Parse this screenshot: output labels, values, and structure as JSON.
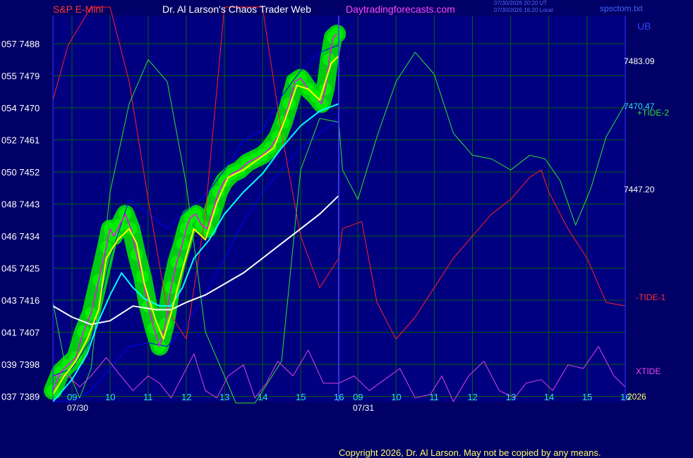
{
  "header": {
    "instrument": "S&P E-Mini",
    "title": "Dr. Al Larson's Chaos Trader Web",
    "site": "Daytradingforecasts.com",
    "stamp_line1": "07/30/2026 20:20 UT",
    "stamp_line2": "07/30/2026 16:20 Local",
    "file": "spsctom.txt"
  },
  "footer": {
    "copyright": "Copyright 2026, Dr. Al Larson. May not be copied by any means."
  },
  "colors": {
    "background": "#000066",
    "plot_background": "#000080",
    "grid": "#0b5d0b",
    "price": "#ff00ff",
    "price_band": "#00ee00",
    "fast_avg": "#ffff00",
    "mid_avg": "#00ffff",
    "slow_avg": "#ffffff",
    "band": "#0000ff",
    "tide1": "#ff2020",
    "tide2": "#30e030",
    "xtide": "#dd44dd",
    "text_header_red": "#ff3333",
    "text_header_white": "#ffffff",
    "text_header_magenta": "#ff44ff"
  },
  "chart_data": {
    "type": "line",
    "y_ticks": [
      "057 7488",
      "055 7479",
      "054 7470",
      "052 7461",
      "050 7452",
      "048 7443",
      "046 7434",
      "045 7425",
      "043 7416",
      "041 7407",
      "039 7398",
      "037 7389"
    ],
    "ylim": [
      7389,
      7494
    ],
    "x_ticks": [
      "09",
      "10",
      "11",
      "12",
      "13",
      "14",
      "15",
      "16",
      "09",
      "10",
      "11",
      "12",
      "13",
      "14",
      "15",
      "16"
    ],
    "date_labels": [
      "07/30",
      "07/31"
    ],
    "right_labels": {
      "ub": "UB",
      "v1": "7483.09",
      "v2": "7470.47",
      "v3": "7447.20",
      "tide2": "+TIDE-2",
      "tide1": "-TIDE-1",
      "xtide": "XTIDE",
      "year": "2026"
    },
    "x_hours_day1": [
      8.5,
      16
    ],
    "x_hours_day2": [
      16,
      23.5
    ],
    "series": [
      {
        "key": "price",
        "values": [
          [
            8.5,
            7392
          ],
          [
            8.7,
            7397
          ],
          [
            8.9,
            7399
          ],
          [
            9.1,
            7401
          ],
          [
            9.3,
            7408
          ],
          [
            9.5,
            7413
          ],
          [
            9.7,
            7422
          ],
          [
            9.9,
            7431
          ],
          [
            10.0,
            7436
          ],
          [
            10.1,
            7434
          ],
          [
            10.25,
            7437
          ],
          [
            10.4,
            7440
          ],
          [
            10.55,
            7436
          ],
          [
            10.7,
            7429
          ],
          [
            10.85,
            7423
          ],
          [
            11.0,
            7415
          ],
          [
            11.15,
            7409
          ],
          [
            11.3,
            7404
          ],
          [
            11.45,
            7410
          ],
          [
            11.6,
            7420
          ],
          [
            11.75,
            7427
          ],
          [
            11.9,
            7432
          ],
          [
            12.0,
            7436
          ],
          [
            12.1,
            7439
          ],
          [
            12.25,
            7440
          ],
          [
            12.4,
            7437
          ],
          [
            12.55,
            7436
          ],
          [
            12.7,
            7441
          ],
          [
            12.85,
            7446
          ],
          [
            13.0,
            7449
          ],
          [
            13.2,
            7451
          ],
          [
            13.4,
            7452
          ],
          [
            13.6,
            7454
          ],
          [
            13.8,
            7455
          ],
          [
            14.0,
            7456
          ],
          [
            14.2,
            7458
          ],
          [
            14.4,
            7461
          ],
          [
            14.55,
            7465
          ],
          [
            14.7,
            7470
          ],
          [
            14.85,
            7476
          ],
          [
            15.0,
            7477
          ],
          [
            15.2,
            7474
          ],
          [
            15.4,
            7472
          ],
          [
            15.55,
            7470
          ],
          [
            15.65,
            7474
          ],
          [
            15.75,
            7482
          ],
          [
            15.85,
            7488
          ],
          [
            15.95,
            7489
          ]
        ]
      },
      {
        "key": "fast_avg",
        "values": [
          [
            8.5,
            7391
          ],
          [
            8.8,
            7396
          ],
          [
            9.1,
            7400
          ],
          [
            9.4,
            7406
          ],
          [
            9.7,
            7414
          ],
          [
            9.9,
            7428
          ],
          [
            10.2,
            7433
          ],
          [
            10.5,
            7436
          ],
          [
            10.7,
            7432
          ],
          [
            10.9,
            7421
          ],
          [
            11.2,
            7411
          ],
          [
            11.4,
            7406
          ],
          [
            11.6,
            7413
          ],
          [
            11.9,
            7425
          ],
          [
            12.2,
            7436
          ],
          [
            12.5,
            7433
          ],
          [
            12.8,
            7443
          ],
          [
            13.1,
            7450
          ],
          [
            13.5,
            7452
          ],
          [
            13.9,
            7455
          ],
          [
            14.3,
            7458
          ],
          [
            14.6,
            7466
          ],
          [
            14.9,
            7475
          ],
          [
            15.2,
            7474
          ],
          [
            15.5,
            7471
          ],
          [
            15.8,
            7481
          ],
          [
            16.0,
            7483
          ]
        ]
      },
      {
        "key": "mid_avg",
        "values": [
          [
            8.5,
            7389
          ],
          [
            9.0,
            7395
          ],
          [
            9.4,
            7402
          ],
          [
            9.7,
            7411
          ],
          [
            10.0,
            7418
          ],
          [
            10.3,
            7424
          ],
          [
            10.6,
            7420
          ],
          [
            10.9,
            7417
          ],
          [
            11.3,
            7415
          ],
          [
            11.6,
            7415
          ],
          [
            11.9,
            7420
          ],
          [
            12.2,
            7428
          ],
          [
            12.6,
            7433
          ],
          [
            13.0,
            7440
          ],
          [
            13.5,
            7446
          ],
          [
            14.0,
            7451
          ],
          [
            14.5,
            7458
          ],
          [
            15.0,
            7464
          ],
          [
            15.5,
            7468
          ],
          [
            16.0,
            7470
          ]
        ]
      },
      {
        "key": "slow_avg",
        "values": [
          [
            8.5,
            7415
          ],
          [
            9.0,
            7412
          ],
          [
            9.5,
            7410
          ],
          [
            10.0,
            7411
          ],
          [
            10.6,
            7415
          ],
          [
            11.2,
            7414
          ],
          [
            11.6,
            7414
          ],
          [
            12.0,
            7416
          ],
          [
            12.5,
            7418
          ],
          [
            13.0,
            7421
          ],
          [
            13.5,
            7424
          ],
          [
            14.0,
            7428
          ],
          [
            14.5,
            7432
          ],
          [
            15.0,
            7436
          ],
          [
            15.5,
            7440
          ],
          [
            16.0,
            7445
          ]
        ]
      },
      {
        "key": "band_upper",
        "values": [
          [
            8.5,
            7396
          ],
          [
            9.0,
            7398
          ],
          [
            9.5,
            7406
          ],
          [
            10.0,
            7428
          ],
          [
            10.5,
            7444
          ],
          [
            11.0,
            7440
          ],
          [
            11.5,
            7436
          ],
          [
            12.0,
            7441
          ],
          [
            12.5,
            7445
          ],
          [
            13.0,
            7452
          ],
          [
            13.5,
            7460
          ],
          [
            14.0,
            7463
          ],
          [
            14.5,
            7472
          ],
          [
            15.0,
            7479
          ],
          [
            15.5,
            7484
          ],
          [
            16.0,
            7486
          ]
        ]
      },
      {
        "key": "band_lower",
        "values": [
          [
            8.5,
            7389
          ],
          [
            9.0,
            7389
          ],
          [
            9.5,
            7392
          ],
          [
            10.0,
            7398
          ],
          [
            10.5,
            7404
          ],
          [
            11.0,
            7405
          ],
          [
            11.5,
            7404
          ],
          [
            12.0,
            7410
          ],
          [
            12.5,
            7418
          ],
          [
            13.0,
            7428
          ],
          [
            13.5,
            7438
          ],
          [
            14.0,
            7446
          ],
          [
            14.5,
            7452
          ],
          [
            15.0,
            7458
          ],
          [
            15.5,
            7462
          ],
          [
            16.0,
            7466
          ]
        ]
      },
      {
        "key": "tide1",
        "values": [
          [
            8.5,
            7471
          ],
          [
            8.9,
            7486
          ],
          [
            9.5,
            7524
          ],
          [
            10.0,
            7498
          ],
          [
            10.5,
            7476
          ],
          [
            11.0,
            7444
          ],
          [
            11.5,
            7414
          ],
          [
            12.0,
            7406
          ],
          [
            12.5,
            7440
          ],
          [
            13.0,
            7498
          ],
          [
            13.5,
            7530
          ],
          [
            14.0,
            7508
          ],
          [
            14.5,
            7462
          ],
          [
            15.0,
            7434
          ],
          [
            15.5,
            7420
          ],
          [
            16.0,
            7428
          ],
          [
            16.1,
            7436
          ],
          [
            16.6,
            7438
          ],
          [
            17.0,
            7416
          ],
          [
            17.5,
            7406
          ],
          [
            18.0,
            7412
          ],
          [
            18.5,
            7420
          ],
          [
            19.0,
            7428
          ],
          [
            19.5,
            7434
          ],
          [
            20.0,
            7440
          ],
          [
            20.5,
            7444
          ],
          [
            21.0,
            7450
          ],
          [
            21.3,
            7452
          ],
          [
            21.5,
            7446
          ],
          [
            22.0,
            7436
          ],
          [
            22.5,
            7428
          ],
          [
            23.0,
            7416
          ],
          [
            23.5,
            7415
          ]
        ]
      },
      {
        "key": "tide2",
        "values": [
          [
            8.5,
            7416
          ],
          [
            8.8,
            7400
          ],
          [
            9.2,
            7390
          ],
          [
            9.5,
            7398
          ],
          [
            10.0,
            7446
          ],
          [
            10.5,
            7470
          ],
          [
            11.0,
            7482
          ],
          [
            11.5,
            7476
          ],
          [
            12.0,
            7448
          ],
          [
            12.5,
            7408
          ],
          [
            13.0,
            7396
          ],
          [
            13.3,
            7370
          ],
          [
            13.8,
            7376
          ],
          [
            14.5,
            7400
          ],
          [
            15.0,
            7452
          ],
          [
            15.5,
            7466
          ],
          [
            16.0,
            7465
          ],
          [
            16.1,
            7452
          ],
          [
            16.5,
            7444
          ],
          [
            17.0,
            7461
          ],
          [
            17.5,
            7476
          ],
          [
            18.0,
            7484
          ],
          [
            18.5,
            7478
          ],
          [
            19.0,
            7462
          ],
          [
            19.5,
            7456
          ],
          [
            20.0,
            7455
          ],
          [
            20.5,
            7452
          ],
          [
            21.0,
            7456
          ],
          [
            21.4,
            7455
          ],
          [
            21.8,
            7449
          ],
          [
            22.2,
            7437
          ],
          [
            22.6,
            7447
          ],
          [
            23.0,
            7461
          ],
          [
            23.5,
            7470
          ]
        ]
      },
      {
        "key": "xtide",
        "values": [
          [
            8.5,
            7396
          ],
          [
            8.9,
            7396
          ],
          [
            9.2,
            7393
          ],
          [
            9.5,
            7396
          ],
          [
            9.9,
            7401
          ],
          [
            10.2,
            7397
          ],
          [
            10.6,
            7392
          ],
          [
            11.0,
            7396
          ],
          [
            11.3,
            7394
          ],
          [
            11.6,
            7390
          ],
          [
            11.9,
            7396
          ],
          [
            12.2,
            7402
          ],
          [
            12.5,
            7392
          ],
          [
            12.8,
            7390
          ],
          [
            13.1,
            7396
          ],
          [
            13.5,
            7399
          ],
          [
            13.8,
            7390
          ],
          [
            14.1,
            7394
          ],
          [
            14.4,
            7400
          ],
          [
            14.8,
            7396
          ],
          [
            15.2,
            7403
          ],
          [
            15.6,
            7394
          ],
          [
            16.0,
            7394
          ],
          [
            16.4,
            7396
          ],
          [
            16.8,
            7392
          ],
          [
            17.2,
            7395
          ],
          [
            17.6,
            7398
          ],
          [
            18.0,
            7390
          ],
          [
            18.4,
            7391
          ],
          [
            18.7,
            7396
          ],
          [
            19.0,
            7389
          ],
          [
            19.4,
            7396
          ],
          [
            19.8,
            7400
          ],
          [
            20.2,
            7392
          ],
          [
            20.6,
            7390
          ],
          [
            20.9,
            7394
          ],
          [
            21.3,
            7395
          ],
          [
            21.6,
            7392
          ],
          [
            22.0,
            7399
          ],
          [
            22.4,
            7398
          ],
          [
            22.8,
            7404
          ],
          [
            23.2,
            7396
          ],
          [
            23.5,
            7393
          ]
        ]
      }
    ]
  }
}
